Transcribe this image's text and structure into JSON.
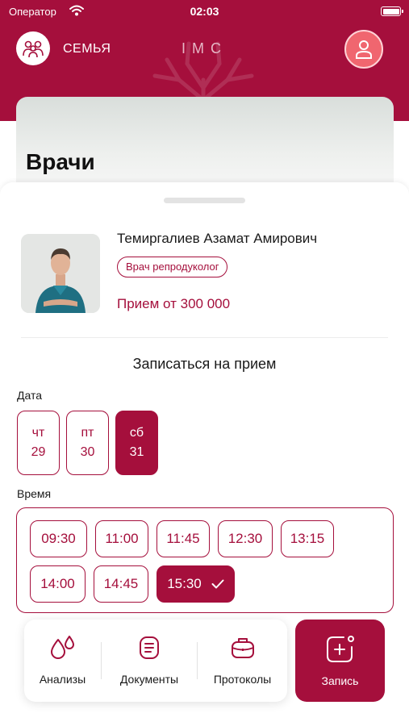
{
  "status_bar": {
    "carrier": "Оператор",
    "time": "02:03"
  },
  "header": {
    "family_label": "СЕМЬЯ",
    "brand": "IMC"
  },
  "page": {
    "title": "Врачи"
  },
  "doctor": {
    "name": "Темиргалиев Азамат Амирович",
    "specialty": "Врач репродуколог",
    "price": "Прием от 300 000"
  },
  "booking": {
    "title": "Записаться на прием",
    "date_label": "Дата",
    "dates": [
      {
        "dow": "чт",
        "day": "29",
        "selected": false
      },
      {
        "dow": "пт",
        "day": "30",
        "selected": false
      },
      {
        "dow": "сб",
        "day": "31",
        "selected": true
      }
    ],
    "time_label": "Время",
    "slots": [
      {
        "time": "09:30",
        "selected": false
      },
      {
        "time": "11:00",
        "selected": false
      },
      {
        "time": "11:45",
        "selected": false
      },
      {
        "time": "12:30",
        "selected": false
      },
      {
        "time": "13:15",
        "selected": false
      },
      {
        "time": "14:00",
        "selected": false
      },
      {
        "time": "14:45",
        "selected": false
      },
      {
        "time": "15:30",
        "selected": true
      }
    ]
  },
  "tabbar": {
    "tabs": [
      {
        "label": "Анализы",
        "icon": "drops-icon"
      },
      {
        "label": "Документы",
        "icon": "document-icon"
      },
      {
        "label": "Протоколы",
        "icon": "briefcase-icon"
      }
    ],
    "record": {
      "label": "Запись",
      "icon": "add-record-icon"
    }
  },
  "colors": {
    "accent": "#a50f3c",
    "profile": "#f0666f",
    "white": "#ffffff"
  }
}
